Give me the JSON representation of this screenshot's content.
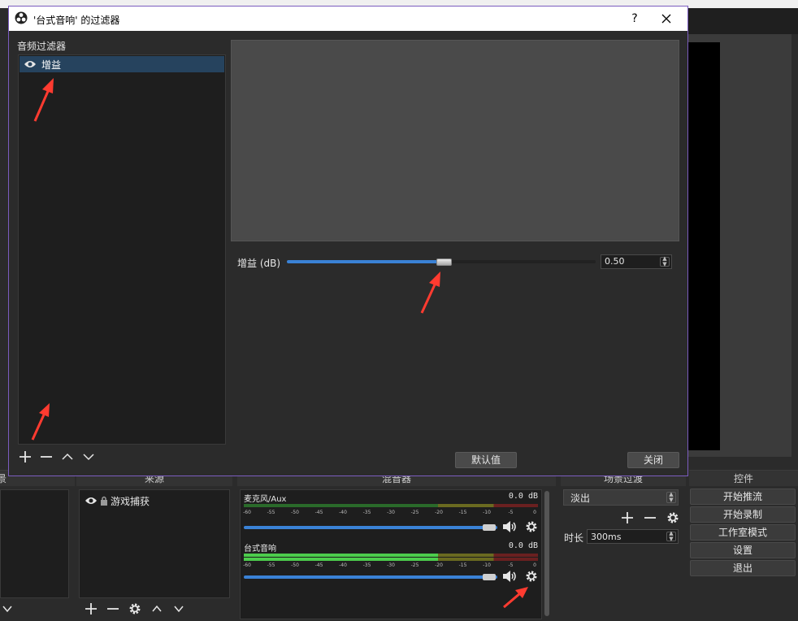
{
  "dialog": {
    "title": "'台式音响' 的过滤器",
    "help_label": "?",
    "filters_label": "音频过滤器",
    "filters": [
      {
        "name": "增益",
        "visible": true
      }
    ],
    "gain_label": "增益 (dB)",
    "gain_value": "0.50",
    "gain_slider_fraction": 0.5,
    "defaults_button": "默认值",
    "close_button": "关闭"
  },
  "docks": {
    "scenes_header": "景",
    "sources_header": "来源",
    "mixer_header": "混音器",
    "transitions_header": "场景过渡",
    "controls_header": "控件"
  },
  "sources": {
    "items": [
      {
        "name": "游戏捕获"
      }
    ]
  },
  "mixer": {
    "channels": [
      {
        "name": "麦克风/Aux",
        "db": "0.0 dB",
        "level_fraction": 0.0,
        "volume_fraction": 1.0
      },
      {
        "name": "台式音响",
        "db": "0.0 dB",
        "level_fraction": 0.66,
        "volume_fraction": 1.0
      }
    ],
    "ticks": [
      "-60",
      "-55",
      "-50",
      "-45",
      "-40",
      "-35",
      "-30",
      "-25",
      "-20",
      "-15",
      "-10",
      "-5",
      "0"
    ]
  },
  "transitions": {
    "selected": "淡出",
    "duration_label": "时长",
    "duration_value": "300ms"
  },
  "controls": {
    "buttons": [
      "开始推流",
      "开始录制",
      "工作室模式",
      "设置",
      "退出"
    ]
  },
  "colors": {
    "accent": "#3a82d6",
    "selection": "#26435e",
    "annotation_arrow": "#ff3b30",
    "dialog_border": "#7b5cbf"
  }
}
